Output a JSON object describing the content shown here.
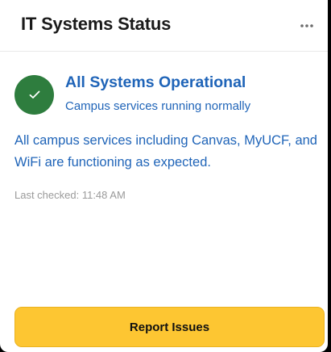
{
  "header": {
    "title": "IT Systems Status",
    "menu_icon": "more-horizontal-icon"
  },
  "status": {
    "icon": "check-icon",
    "icon_color": "#2e7d3e",
    "title": "All Systems Operational",
    "subtitle": "Campus services running normally",
    "text_color": "#1f64b8"
  },
  "description": "All campus services including Canvas, MyUCF, and WiFi are functioning as expected.",
  "last_checked": "Last checked: 11:48 AM",
  "actions": {
    "report_label": "Report Issues",
    "report_color": "#fdc632"
  }
}
